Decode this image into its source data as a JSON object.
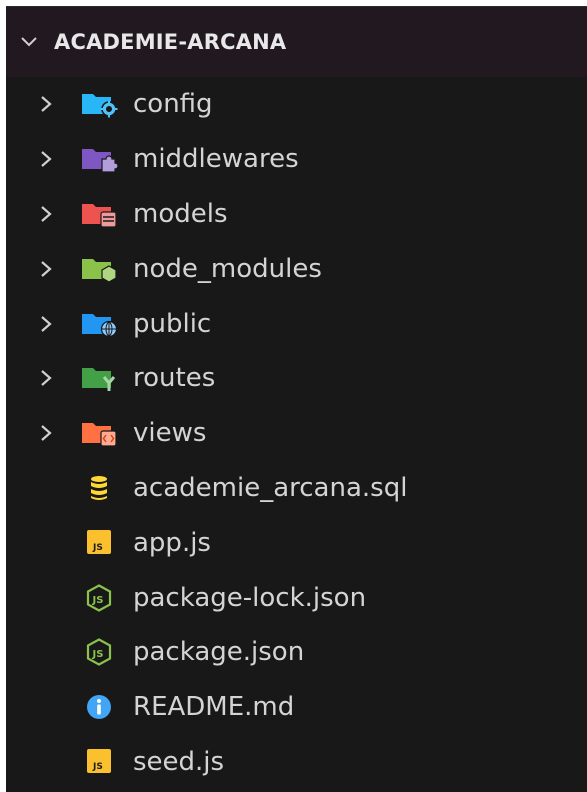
{
  "explorer": {
    "root_folder": "ACADEMIE-ARCANA",
    "items": [
      {
        "label": "config",
        "kind": "folder",
        "icon": "folder-config-icon",
        "color": "#29b6f6"
      },
      {
        "label": "middlewares",
        "kind": "folder",
        "icon": "folder-middleware-icon",
        "color": "#7e57c2"
      },
      {
        "label": "models",
        "kind": "folder",
        "icon": "folder-database-icon",
        "color": "#ef5350"
      },
      {
        "label": "node_modules",
        "kind": "folder",
        "icon": "folder-node-icon",
        "color": "#8bc34a"
      },
      {
        "label": "public",
        "kind": "folder",
        "icon": "folder-public-icon",
        "color": "#2196f3"
      },
      {
        "label": "routes",
        "kind": "folder",
        "icon": "folder-routes-icon",
        "color": "#43a047"
      },
      {
        "label": "views",
        "kind": "folder",
        "icon": "folder-views-icon",
        "color": "#ff7043"
      },
      {
        "label": "academie_arcana.sql",
        "kind": "file",
        "icon": "database-icon",
        "color": "#fdd835"
      },
      {
        "label": "app.js",
        "kind": "file",
        "icon": "javascript-icon",
        "color": "#fbc02d"
      },
      {
        "label": "package-lock.json",
        "kind": "file",
        "icon": "nodejs-icon",
        "color": "#8bc34a"
      },
      {
        "label": "package.json",
        "kind": "file",
        "icon": "nodejs-icon",
        "color": "#8bc34a"
      },
      {
        "label": "README.md",
        "kind": "file",
        "icon": "info-icon",
        "color": "#42a5f5"
      },
      {
        "label": "seed.js",
        "kind": "file",
        "icon": "javascript-icon",
        "color": "#fbc02d"
      }
    ]
  },
  "colors": {
    "background": "#181818",
    "header_background": "#211820",
    "text": "#d4d4d4"
  }
}
